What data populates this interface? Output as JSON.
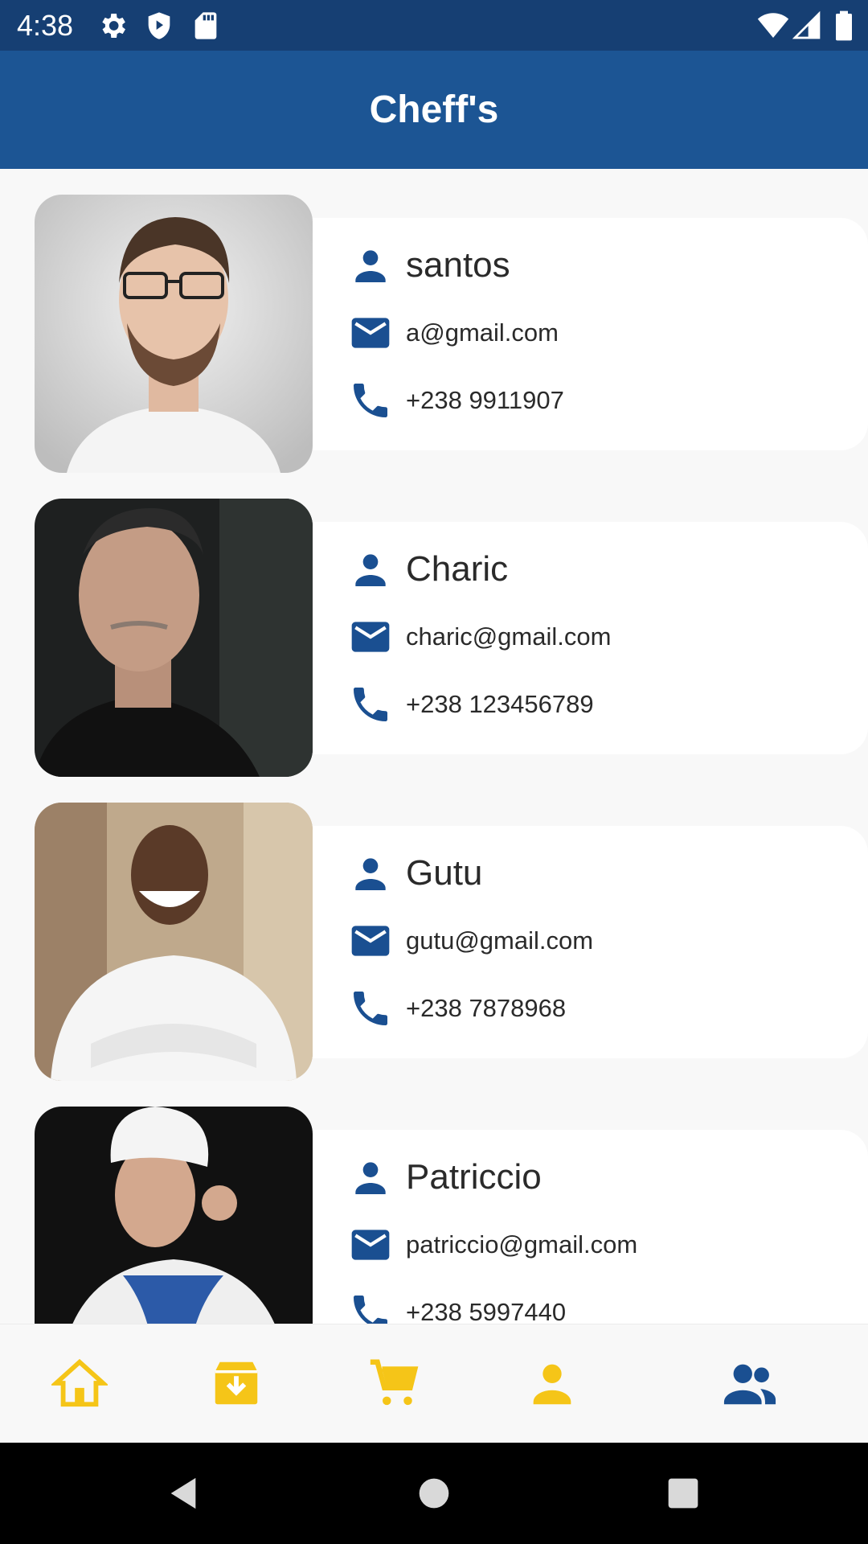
{
  "status_bar": {
    "time": "4:38",
    "icons": [
      "settings-icon",
      "shield-play-icon",
      "sd-card-icon",
      "wifi-icon",
      "signal-icon",
      "battery-icon"
    ]
  },
  "app_bar": {
    "title": "Cheff's"
  },
  "chefs": [
    {
      "name": "santos",
      "email": "a@gmail.com",
      "phone": "+238 9911907"
    },
    {
      "name": "Charic",
      "email": "charic@gmail.com",
      "phone": "+238 123456789"
    },
    {
      "name": "Gutu",
      "email": "gutu@gmail.com",
      "phone": "+238 7878968"
    },
    {
      "name": "Patriccio",
      "email": "patriccio@gmail.com",
      "phone": "+238 5997440"
    }
  ],
  "bottom_nav": {
    "items": [
      "home-icon",
      "inbox-download-icon",
      "cart-icon",
      "person-icon",
      "people-icon"
    ],
    "active": "people-icon"
  },
  "colors": {
    "primary": "#1c5594",
    "status_bar": "#163f73",
    "icon_blue": "#1a4f91",
    "nav_inactive": "#f5c518",
    "background": "#f8f8f8"
  }
}
